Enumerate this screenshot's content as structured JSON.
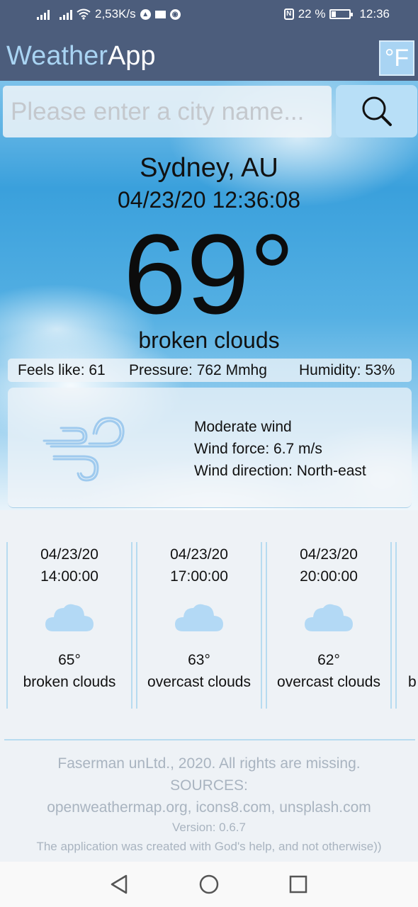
{
  "status_bar": {
    "net_speed": "2,53K/s",
    "battery": "22 %",
    "time": "12:36",
    "icons": [
      "signal-icon",
      "signal-icon",
      "wifi-icon",
      "vpn-icon",
      "mail-icon",
      "chrome-icon",
      "nfc-icon",
      "battery-icon"
    ]
  },
  "app": {
    "title_part1": "Weather",
    "title_part2": "App",
    "unit_button": "°F",
    "search_placeholder": "Please enter a city name...",
    "search_icon": "search-icon"
  },
  "current": {
    "city": "Sydney, AU",
    "datetime": "04/23/20 12:36:08",
    "temperature": "69°",
    "description": "broken clouds",
    "feels_like": "Feels like: 61",
    "pressure": "Pressure: 762 Mmhg",
    "humidity": "Humidity: 53%"
  },
  "wind": {
    "icon": "wind-icon",
    "label": "Moderate wind",
    "force": "Wind force: 6.7 m/s",
    "direction": "Wind direction: North-east"
  },
  "forecast": [
    {
      "date": "04/23/20",
      "time": "14:00:00",
      "temp": "65°",
      "desc": "broken clouds",
      "icon": "cloud-icon"
    },
    {
      "date": "04/23/20",
      "time": "17:00:00",
      "temp": "63°",
      "desc": "overcast clouds",
      "icon": "cloud-icon"
    },
    {
      "date": "04/23/20",
      "time": "20:00:00",
      "temp": "62°",
      "desc": "overcast clouds",
      "icon": "cloud-icon"
    },
    {
      "desc": "b"
    }
  ],
  "footer": {
    "copyright": "Faserman unLtd., 2020. All rights are missing.",
    "sources_label": "SOURCES:",
    "sources": "openweathermap.org, icons8.com, unsplash.com",
    "version": "Version: 0.6.7",
    "note": "The application was created with God's help, and not otherwise))"
  },
  "colors": {
    "app_bar": "#4c5d7c",
    "accent": "#a9d4f3",
    "footer_text": "#a9b4c0"
  }
}
